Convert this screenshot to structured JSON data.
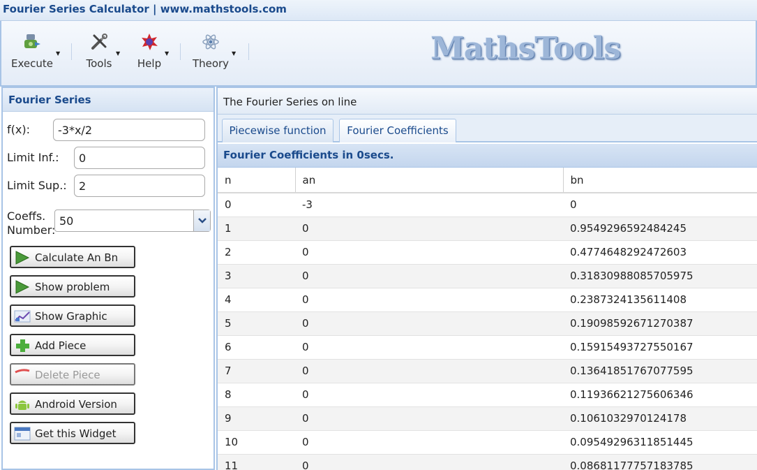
{
  "window": {
    "title": "Fourier Series Calculator | www.mathstools.com"
  },
  "toolbar": {
    "execute": "Execute",
    "tools": "Tools",
    "help": "Help",
    "theory": "Theory",
    "logo": "MathsTools"
  },
  "left": {
    "header": "Fourier Series",
    "fx_label": "f(x):",
    "fx_value": "-3*x/2",
    "inf_label": "Limit Inf.:",
    "inf_value": "0",
    "sup_label": "Limit Sup.:",
    "sup_value": "2",
    "coeffs_label_1": "Coeffs.",
    "coeffs_label_2": "Number:",
    "coeffs_value": "50",
    "buttons": {
      "calculate": "Calculate An Bn",
      "show_problem": "Show problem",
      "show_graphic": "Show Graphic",
      "add_piece": "Add Piece",
      "delete_piece": "Delete Piece",
      "android": "Android Version",
      "widget": "Get this Widget"
    }
  },
  "right": {
    "header": "The Fourier Series on line",
    "tabs": [
      "Piecewise function",
      "Fourier Coefficients"
    ],
    "coef_header": "Fourier Coefficients in 0secs.",
    "columns": [
      "n",
      "an",
      "bn"
    ],
    "rows": [
      [
        "0",
        "-3",
        "0"
      ],
      [
        "1",
        "0",
        "0.9549296592484245"
      ],
      [
        "2",
        "0",
        "0.4774648292472603"
      ],
      [
        "3",
        "0",
        "0.31830988085705975"
      ],
      [
        "4",
        "0",
        "0.2387324135611408"
      ],
      [
        "5",
        "0",
        "0.19098592671270387"
      ],
      [
        "6",
        "0",
        "0.15915493727550167"
      ],
      [
        "7",
        "0",
        "0.13641851767077595"
      ],
      [
        "8",
        "0",
        "0.11936621275606346"
      ],
      [
        "9",
        "0",
        "0.1061032970124178"
      ],
      [
        "10",
        "0",
        "0.09549296311851445"
      ],
      [
        "11",
        "0",
        "0.08681177757183785"
      ]
    ]
  },
  "colors": {
    "accent": "#1a4a8c",
    "border": "#a8c4e6"
  }
}
